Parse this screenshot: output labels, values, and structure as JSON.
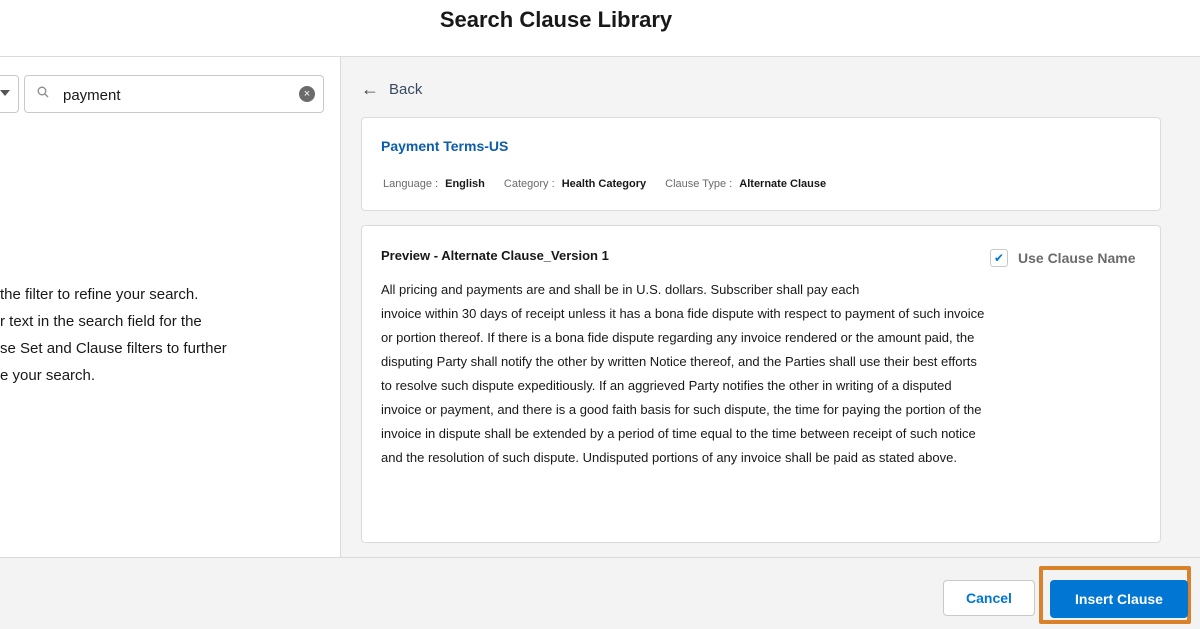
{
  "modal": {
    "title": "Search Clause Library"
  },
  "search": {
    "value": "payment"
  },
  "left_panel": {
    "help_lines": [
      "the filter to refine your search.",
      "r text in the search field for the",
      "se Set and Clause filters to further",
      "e your search."
    ]
  },
  "back": {
    "label": "Back"
  },
  "clause": {
    "name": "Payment Terms-US",
    "language_label": "Language :",
    "language_value": "English",
    "category_label": "Category :",
    "category_value": "Health Category",
    "type_label": "Clause Type :",
    "type_value": "Alternate Clause"
  },
  "preview": {
    "title": "Preview - Alternate Clause_Version 1",
    "use_clause_name_label": "Use Clause Name",
    "use_clause_name_checked": true,
    "body_lines": [
      "All pricing and payments are and shall be in U.S. dollars. Subscriber shall pay each",
      "invoice within 30 days of receipt unless it has a bona fide dispute with respect to payment of such invoice",
      "or portion thereof. If there is a bona fide dispute regarding any invoice rendered or the amount paid, the",
      "disputing Party shall notify the other by written Notice thereof, and the Parties shall use their best efforts",
      "to resolve such dispute expeditiously. If an aggrieved Party notifies the other in writing of a disputed",
      "invoice or payment, and there is a good faith basis for such dispute, the time for paying the portion of the",
      "invoice in dispute shall be extended by a period of time equal to the time between receipt of such notice",
      "and the resolution of such dispute. Undisputed portions of any invoice shall be paid as stated above."
    ]
  },
  "footer": {
    "cancel_label": "Cancel",
    "insert_label": "Insert Clause"
  },
  "colors": {
    "brand": "#0176d3",
    "highlight": "#d9822b",
    "link": "#0b5cab"
  }
}
